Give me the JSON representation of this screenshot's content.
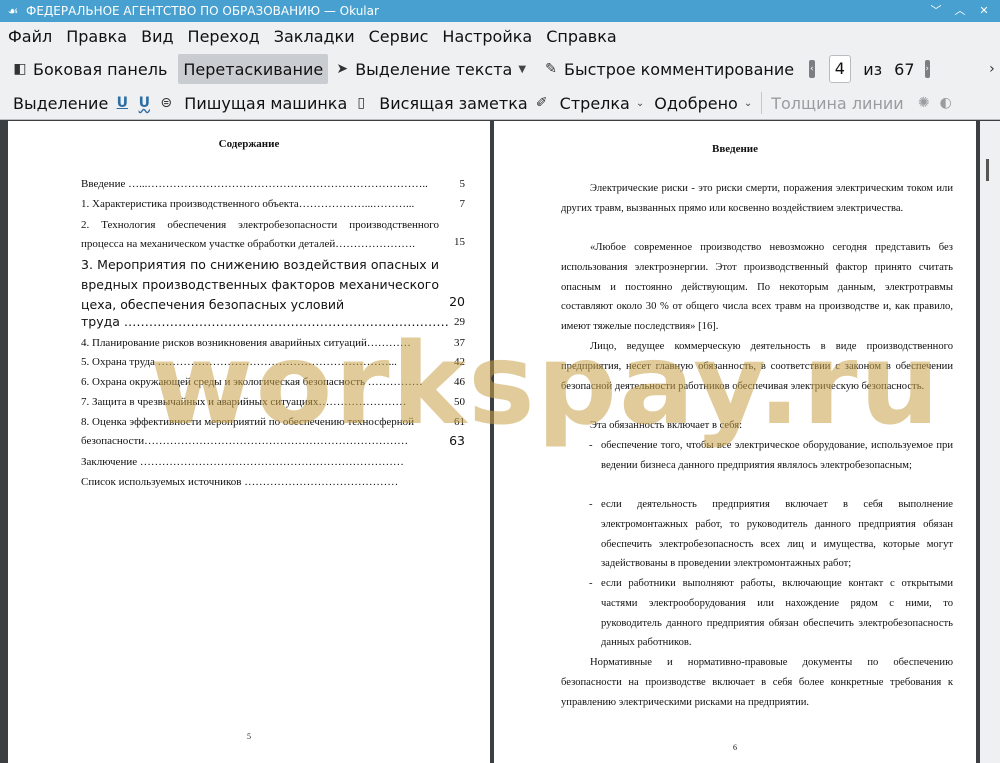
{
  "window": {
    "title": "ФЕДЕРАЛЬНОЕ АГЕНТСТВО ПО ОБРАЗОВАНИЮ  — Okular",
    "app_icon": "okular-icon",
    "buttons": [
      "chevron-down-icon",
      "chevron-up-icon",
      "close-icon"
    ]
  },
  "menu": [
    "Файл",
    "Правка",
    "Вид",
    "Переход",
    "Закладки",
    "Сервис",
    "Настройка",
    "Справка"
  ],
  "toolbar": {
    "sidebar_label": "Боковая панель",
    "drag_label": "Перетаскивание",
    "text_select_label": "Выделение текста",
    "quick_comment_label": "Быстрое комментирование",
    "page_current": "4",
    "page_of": "из",
    "page_total": "67"
  },
  "annot_toolbar": {
    "select_label": "Выделение",
    "typewriter_label": "Пишущая машинка",
    "sticky_note_label": "Висящая заметка",
    "arrow_label": "Стрелка",
    "stamp_label": "Одобрено",
    "line_width_label": "Толщина линии"
  },
  "page5": {
    "title": "Содержание",
    "toc": [
      {
        "label": "Введение …...…………………………………………………………………..",
        "page": "5"
      },
      {
        "label": "1.   Характеристика производственного объекта………………...………...",
        "page": "7"
      },
      {
        "label": "2.   Технология обеспечения электробезопасности производственного процесса на механическом участке обработки деталей………………….",
        "page": "15"
      },
      {
        "label": "3. Мероприятия по снижению воздействия опасных и вредных производственных факторов механического цеха, обеспечения безопасных условий",
        "page": "20"
      },
      {
        "label": "труда ……………………………………………………………………",
        "page": "29"
      },
      {
        "label": "4.   Планирование рисков возникновения аварийных ситуаций…………",
        "page": "37"
      },
      {
        "label": "5.   Охрана труда ………………………………………………………...",
        "page": "42"
      },
      {
        "label": "6.   Охрана окружающей среды и экологическая  безопасность ……………",
        "page": "46"
      },
      {
        "label": "7.   Защита в чрезвычайных и аварийных ситуациях……………………",
        "page": "50"
      },
      {
        "label": "8.   Оценка эффективности мероприятий по обеспечению техносферной",
        "page": "61"
      },
      {
        "label": "безопасности………………………………………………………………",
        "page": "63"
      },
      {
        "label": "Заключение ………………………………………………………………",
        "page": ""
      },
      {
        "label": "Список используемых источников ……………………………………",
        "page": ""
      }
    ],
    "page_number": "5"
  },
  "page6": {
    "title": "Введение",
    "p1": "Электрические риски - это риски смерти, поражения электрическим током или других травм, вызванных прямо или косвенно воздействием электричества.",
    "p2": "«Любое современное производство невозможно сегодня представить без использования электроэнергии. Этот производственный фактор принято считать опасным и постоянно действующим. По некоторым данным, электротравмы составляют около 30 % от общего числа всех травм на производстве и, как правило, имеют тяжелые последствия» [16].",
    "p3": "Лицо, ведущее коммерческую деятельность в виде производственного предприятия, несет главную обязанность, в соответствии с законом в обеспечении безопасной деятельности работников обеспечивая электрическую безопасность.",
    "p4": "Эта обязанность включает в себя:",
    "bullets": [
      "обеспечение того, чтобы все электрическое оборудование, используемое при ведении бизнеса данного предприятия являлось электробезопасным;",
      "если деятельность предприятия включает в себя выполнение электромонтажных работ, то руководитель данного предприятия обязан обеспечить электробезопасность всех лиц и имущества, которые могут задействованы в проведении электромонтажных работ;",
      "если работники выполняют работы, включающие контакт с открытыми частями электрооборудования или нахождение рядом с ними, то руководитель данного предприятия обязан обеспечить электробезопасность данных работников."
    ],
    "p5": "Нормативные и нормативно-правовые документы по обеспечению безопасности на производстве включает в себя более конкретные требования к управлению электрическими рисками на предприятии.",
    "page_number": "6"
  },
  "watermark": "workspay.ru",
  "colors": {
    "titlebar": "#47a0cf",
    "chrome": "#eff0f1",
    "background": "#3c3f42",
    "watermark": "#c9a24a"
  }
}
